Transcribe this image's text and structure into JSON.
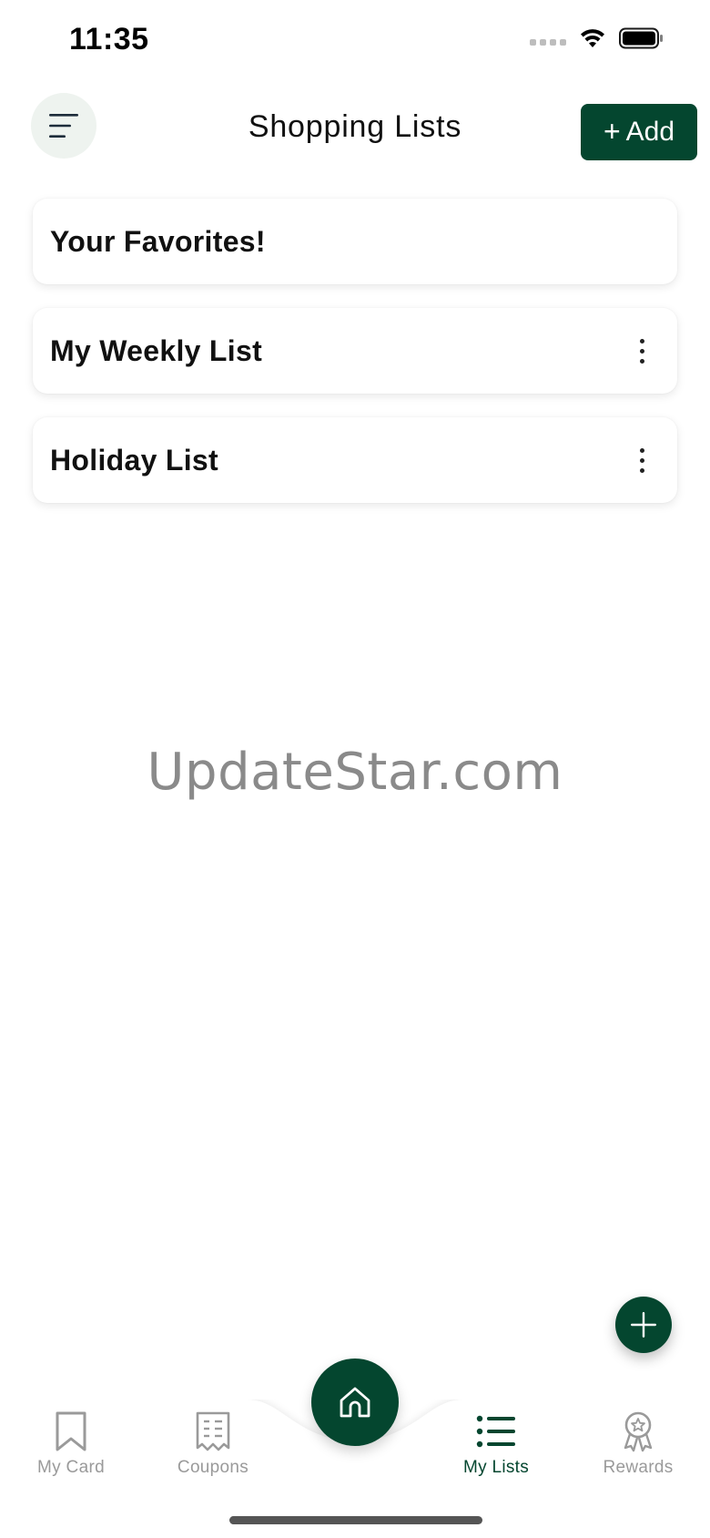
{
  "status_bar": {
    "time": "11:35"
  },
  "header": {
    "title": "Shopping Lists",
    "add_label": "Add",
    "menu_icon": "hamburger-menu-icon"
  },
  "lists": [
    {
      "title": "Your Favorites!",
      "has_menu": false
    },
    {
      "title": "My Weekly List",
      "has_menu": true
    },
    {
      "title": "Holiday List",
      "has_menu": true
    }
  ],
  "watermark": "UpdateStar.com",
  "bottom_nav": {
    "items": [
      {
        "label": "My Card",
        "icon": "bookmark-icon",
        "active": false
      },
      {
        "label": "Coupons",
        "icon": "receipt-icon",
        "active": false
      },
      {
        "label": "My Lists",
        "icon": "list-icon",
        "active": true
      },
      {
        "label": "Rewards",
        "icon": "award-ribbon-icon",
        "active": false
      }
    ],
    "center_icon": "home-icon"
  },
  "colors": {
    "brand": "#04462f",
    "inactive": "#9a9a9a",
    "menu_bg": "#eef3ef"
  }
}
